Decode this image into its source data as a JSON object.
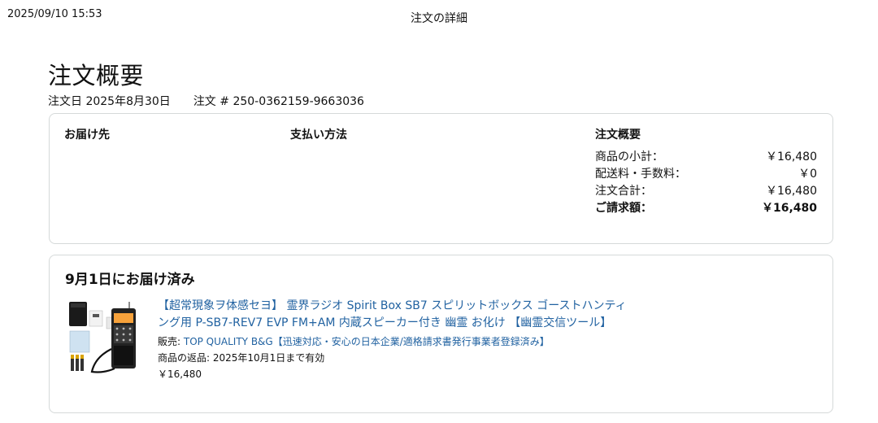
{
  "header": {
    "print_datetime": "2025/09/10 15:53",
    "page_heading": "注文の詳細"
  },
  "order": {
    "title": "注文概要",
    "date_label": "注文日 2025年8月30日",
    "number_label": "注文 # 250-0362159-9663036"
  },
  "summary_box": {
    "shipping_to_label": "お届け先",
    "payment_label": "支払い方法",
    "summary_label": "注文概要",
    "rows": [
      {
        "label": "商品の小計：",
        "value": "￥16,480"
      },
      {
        "label": "配送料・手数料：",
        "value": "￥0"
      },
      {
        "label": "注文合計：",
        "value": "￥16,480"
      },
      {
        "label": "ご請求額：",
        "value": "￥16,480"
      }
    ]
  },
  "shipment": {
    "status": "9月1日にお届け済み",
    "item": {
      "title": "【超常現象ヲ体感セヨ】 霊界ラジオ Spirit Box SB7 スピリットボックス ゴーストハンティング用 P-SB7-REV7 EVP FM+AM 内蔵スピーカー付き 幽霊 お化け 【幽霊交信ツール】",
      "seller_prefix": "販売: ",
      "seller_name": "TOP QUALITY B&G【迅速対応・安心の日本企業/適格請求書発行事業者登録済み】",
      "return_info": "商品の返品: 2025年10月1日まで有効",
      "price": "￥16,480",
      "thumbnail_icon": "product-radio-image"
    }
  },
  "colors": {
    "link": "#2162a1",
    "border": "#d5d9d9",
    "text": "#111111"
  }
}
